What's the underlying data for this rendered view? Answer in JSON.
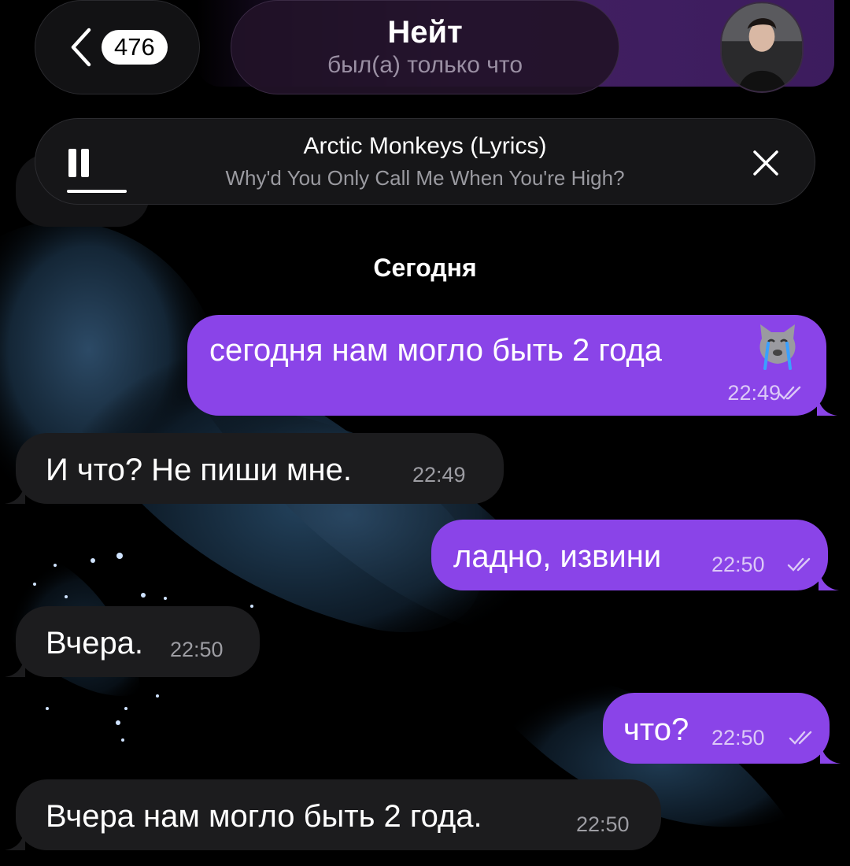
{
  "header": {
    "back_count": "476",
    "chat_name": "Нейт",
    "chat_status": "был(а) только что"
  },
  "music": {
    "artist": "Arctic Monkeys (Lyrics)",
    "title": "Why'd You Only Call Me When You're High?"
  },
  "date_separator": "Сегодня",
  "messages": [
    {
      "direction": "out",
      "text": "сегодня нам могло быть 2 года",
      "time": "22:49",
      "sticker": "crying-cat-emoji"
    },
    {
      "direction": "in",
      "text": "И что? Не пиши мне.",
      "time": "22:49"
    },
    {
      "direction": "out",
      "text": "ладно, извини",
      "time": "22:50"
    },
    {
      "direction": "in",
      "text": "Вчера.",
      "time": "22:50"
    },
    {
      "direction": "out",
      "text": "что?",
      "time": "22:50"
    },
    {
      "direction": "in",
      "text": "Вчера нам могло быть 2 года.",
      "time": "22:50"
    }
  ],
  "colors": {
    "outgoing_bubble": "#8a44e8",
    "incoming_bubble": "#1c1c1e",
    "header_glow": "#7a3cb4"
  }
}
